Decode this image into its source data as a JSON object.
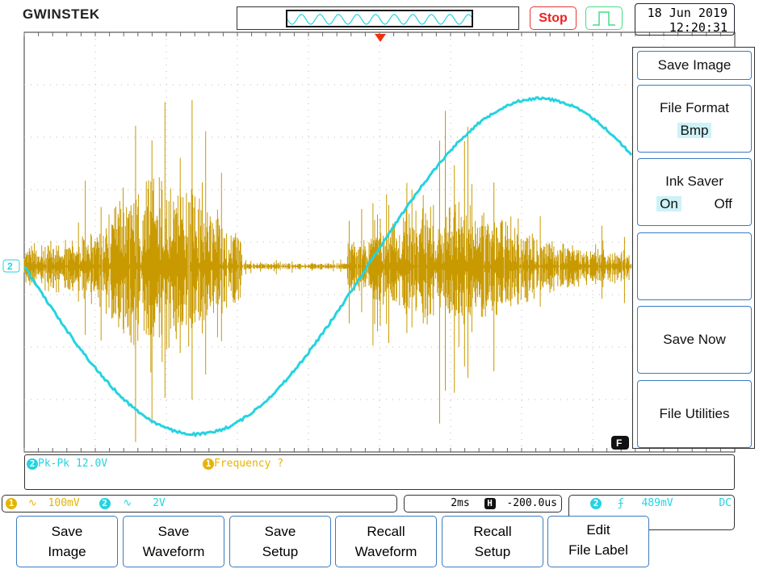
{
  "brand": "GWINSTEK",
  "status": {
    "run_state": "Stop",
    "date": "18 Jun 2019",
    "time": "12:20:31"
  },
  "colors": {
    "ch1": "#e6b400",
    "ch2": "#25d3e0",
    "accent": "#3a7bc0",
    "stop": "#e22222"
  },
  "side_menu": {
    "title": "Save Image",
    "file_format": {
      "label": "File Format",
      "value": "Bmp"
    },
    "ink_saver": {
      "label": "Ink Saver",
      "on": "On",
      "off": "Off",
      "selected": "On"
    },
    "save_now": "Save Now",
    "file_utilities": "File Utilities"
  },
  "measurements": {
    "m1_label": "Pk-Pk 12.0V",
    "m2_label": "Frequency ?",
    "m1_channel": "2",
    "m2_channel": "1"
  },
  "channels": {
    "ch1": {
      "id": "1",
      "coupling": "∿",
      "scale": "100mV"
    },
    "ch2": {
      "id": "2",
      "coupling": "∿",
      "scale": "2V"
    }
  },
  "timebase": {
    "scale": "2ms",
    "h_icon": "H",
    "position": "-200.0us"
  },
  "trigger": {
    "source": "2",
    "slope": "rising-edge-icon",
    "level": "489mV",
    "coupling": "DC"
  },
  "bottom_menu": [
    {
      "l1": "Save",
      "l2": "Image"
    },
    {
      "l1": "Save",
      "l2": "Waveform"
    },
    {
      "l1": "Save",
      "l2": "Setup"
    },
    {
      "l1": "Recall",
      "l2": "Waveform"
    },
    {
      "l1": "Recall",
      "l2": "Setup"
    },
    {
      "l1": "Edit",
      "l2": "File Label"
    }
  ],
  "ch2_marker": "2",
  "f_marker": "F"
}
